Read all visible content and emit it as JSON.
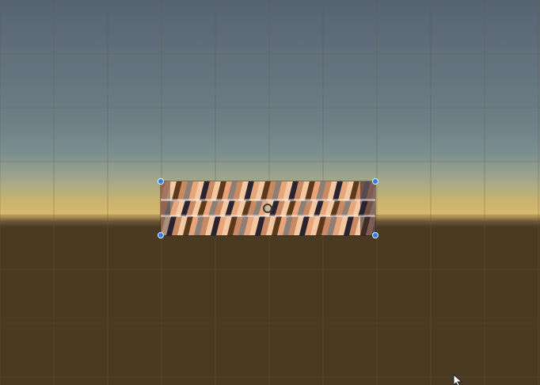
{
  "scene": {
    "colors": {
      "sky_top": "#566472",
      "sky_mid": "#7a8e92",
      "horizon_glow": "#d7b86c",
      "ground": "#4a3a22",
      "grid_line": "#6b5a40",
      "handle": "#2f7fe0"
    },
    "sprite": {
      "name": "patterned-sprite",
      "icon": "sprite-icon",
      "palette": [
        "#e8a47a",
        "#f2c9a2",
        "#5a3a1a",
        "#2a2330",
        "#8c7f76",
        "#c98a63",
        "#ffffff"
      ]
    },
    "gizmo": {
      "handle_icon": "rect-handle-icon",
      "pivot_icon": "pivot-icon"
    },
    "cursor_icon": "arrow-cursor-icon"
  }
}
